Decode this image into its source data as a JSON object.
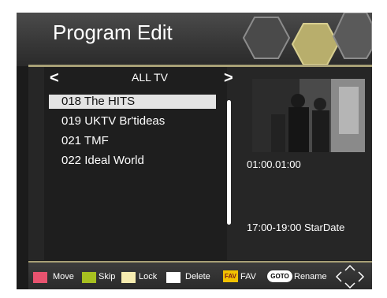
{
  "header": {
    "title": "Program Edit"
  },
  "list": {
    "group_title": "ALL TV",
    "prev_symbol": "<",
    "next_symbol": ">",
    "channels": [
      {
        "label": "018 The HITS",
        "selected": true
      },
      {
        "label": "019 UKTV Br'tideas",
        "selected": false
      },
      {
        "label": "021 TMF",
        "selected": false
      },
      {
        "label": "022 Ideal World",
        "selected": false
      }
    ]
  },
  "info": {
    "time": "01:00.01:00",
    "epg": "17:00-19:00  StarDate"
  },
  "footer": {
    "move_label": "Move",
    "skip_label": "Skip",
    "lock_label": "Lock",
    "delete_label": "Delete",
    "fav_badge": "FAV",
    "fav_label": "FAV",
    "goto_badge": "GOTO",
    "rename_label": "Rename"
  },
  "colors": {
    "move": "#e8536f",
    "skip": "#a7c020",
    "lock": "#f6ecb0",
    "delete": "#ffffff",
    "fav": "#f2c200",
    "accent_line": "#a8a076"
  },
  "icons": [
    "hexagon-decor-icon",
    "left-arrow-icon",
    "right-arrow-icon",
    "navigation-arrows-icon"
  ]
}
